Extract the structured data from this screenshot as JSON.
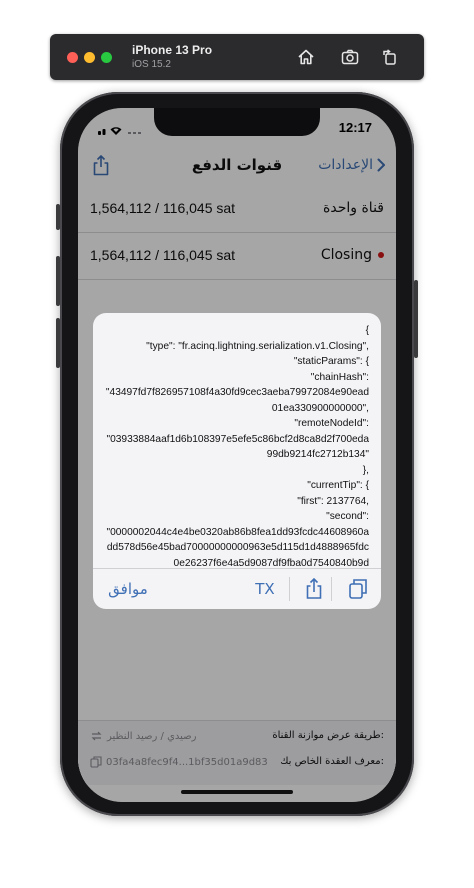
{
  "simulator": {
    "title": "iPhone 13 Pro",
    "subtitle": "iOS 15.2"
  },
  "status": {
    "time": "12:17"
  },
  "nav": {
    "title": "قنوات الدفع",
    "back_label": "الإعدادات"
  },
  "channels": [
    {
      "amount": "1,564,112 / 116,045 sat",
      "label": "قناة واحدة"
    },
    {
      "amount": "1,564,112 / 116,045 sat",
      "label": "Closing"
    }
  ],
  "alert": {
    "json_text": "{\n\"type\": \"fr.acinq.lightning.serialization.v1.Closing\",\n\"staticParams\": {\n\"chainHash\":\n\"43497fd7f826957108f4a30fd9cec3aeba79972084e90ead01ea330900000000\",\n\"remoteNodeId\":\n\"03933884aaf1d6b108397e5efe5c86bcf2d8ca8d2f700eda99db9214fc2712b134\"\n},\n\"currentTip\": {\n\"first\": 2137764,\n\"second\":\n\"0000002044c4e4be0320ab86b8fea1dd93fcdc44608960add578d56e45bad70000000000963e5d115d1d4888965fdc0e26237f6e4a5d9087df9fba0d7540840b9d",
    "ok_label": "موافق",
    "tx_label": "TX"
  },
  "footer": {
    "balance_label": "طريقة عرض موازنة القناة:",
    "balance_value": "رصيدي / رصيد النظير",
    "node_id_label": "معرف العقدة الخاص بك:",
    "node_id_value": "03fa4a8fec9f4...1bf35d01a9d83"
  },
  "colors": {
    "accent": "#3f6fb4",
    "closing_dot": "#d11919"
  }
}
